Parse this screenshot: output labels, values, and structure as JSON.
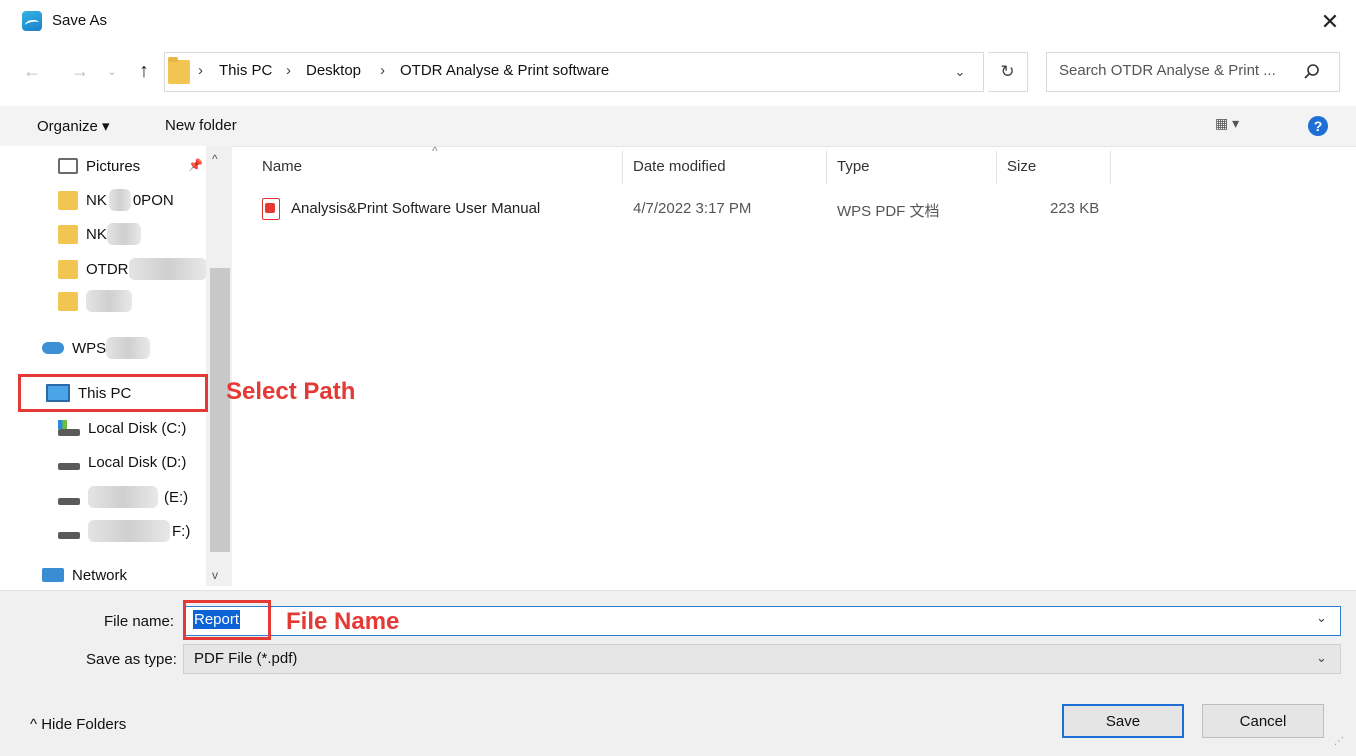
{
  "window": {
    "title": "Save As",
    "close_label": "✕"
  },
  "address": {
    "crumbs": [
      "This PC",
      "Desktop",
      "OTDR Analyse & Print software"
    ],
    "separator": "›",
    "search_placeholder": "Search OTDR Analyse & Print ..."
  },
  "toolbar": {
    "organize": "Organize ▾",
    "new_folder": "New folder",
    "help": "?",
    "view": "▦ ▾"
  },
  "nav": {
    "items": [
      {
        "label": "Pictures"
      },
      {
        "label": "NK",
        "label_tail": "0PON"
      },
      {
        "label": "NK"
      },
      {
        "label": "OTDR"
      },
      {
        "label": ""
      },
      {
        "label": "WPS"
      },
      {
        "label": "This PC"
      },
      {
        "label": "Local Disk (C:)"
      },
      {
        "label": "Local Disk (D:)"
      },
      {
        "label": "(E:)"
      },
      {
        "label": "F:)"
      },
      {
        "label": "Network"
      }
    ]
  },
  "annotations": {
    "select_path": "Select Path",
    "file_name": "File Name"
  },
  "columns": {
    "name": "Name",
    "date": "Date modified",
    "type": "Type",
    "size": "Size"
  },
  "files": [
    {
      "name": "Analysis&Print Software User Manual",
      "date": "4/7/2022 3:17 PM",
      "type": "WPS PDF 文档",
      "size": "223 KB"
    }
  ],
  "form": {
    "file_name_label": "File name:",
    "file_name_value": "Report",
    "type_label": "Save as type:",
    "type_value": "PDF File (*.pdf)"
  },
  "footer": {
    "hide_folders": "Hide Folders",
    "save": "Save",
    "cancel": "Cancel"
  },
  "colors": {
    "accent": "#1d6fd6",
    "annotation": "#e53935",
    "folder": "#f2c552"
  }
}
